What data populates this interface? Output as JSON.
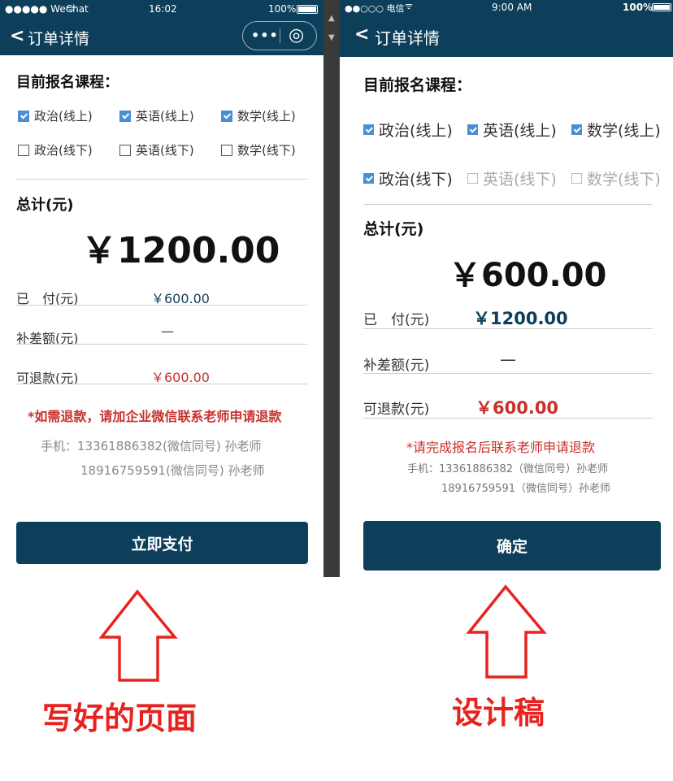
{
  "left": {
    "status": {
      "carrier": "●●●●● WeChat",
      "time": "16:02",
      "battery": "100%"
    },
    "nav": {
      "back": "<",
      "title": "订单详情",
      "more": "•••",
      "target": "◎"
    },
    "course_heading": "目前报名课程：",
    "courses": [
      {
        "label": "政治(线上)",
        "checked": true
      },
      {
        "label": "英语(线上)",
        "checked": true
      },
      {
        "label": "数学(线上)",
        "checked": true
      },
      {
        "label": "政治(线下)",
        "checked": false
      },
      {
        "label": "英语(线下)",
        "checked": false
      },
      {
        "label": "数学(线下)",
        "checked": false
      }
    ],
    "total_label": "总计(元)",
    "total_value": "￥1200.00",
    "paid_label": "已　付(元)",
    "paid_value": "￥600.00",
    "diff_label": "补差额(元)",
    "diff_value": "—",
    "refund_label": "可退款(元)",
    "refund_value": "￥600.00",
    "notice": "*如需退款，请加企业微信联系老师申请退款",
    "contact1": "手机：13361886382(微信同号)  孙老师",
    "contact2": "18916759591(微信同号)  孙老师",
    "button": "立即支付",
    "colors": {
      "primary": "#0d3f5a",
      "accent_red": "#c9302c",
      "paid_blue": "#0d3f5a"
    }
  },
  "right": {
    "status": {
      "carrier": "●●○○○ 电信",
      "time": "9:00 AM",
      "battery": "100%"
    },
    "nav": {
      "back": "<",
      "title": "订单详情"
    },
    "course_heading": "目前报名课程：",
    "courses": [
      {
        "label": "政治(线上)",
        "checked": true
      },
      {
        "label": "英语(线上)",
        "checked": true
      },
      {
        "label": "数学(线上)",
        "checked": true
      },
      {
        "label": "政治(线下)",
        "checked": true
      },
      {
        "label": "英语(线下)",
        "checked": false
      },
      {
        "label": "数学(线下)",
        "checked": false
      }
    ],
    "total_label": "总计(元)",
    "total_value": "￥600.00",
    "paid_label": "已　付(元)",
    "paid_value": "￥1200.00",
    "diff_label": "补差额(元)",
    "diff_value": "—",
    "refund_label": "可退款(元)",
    "refund_value": "￥600.00",
    "notice": "*请完成报名后联系老师申请退款",
    "contact1": "手机：13361886382（微信同号）孙老师",
    "contact2": "18916759591（微信同号）孙老师",
    "button": "确定"
  },
  "captions": {
    "left": "写好的页面",
    "right": "设计稿"
  },
  "arrow_color": "#e8231f"
}
